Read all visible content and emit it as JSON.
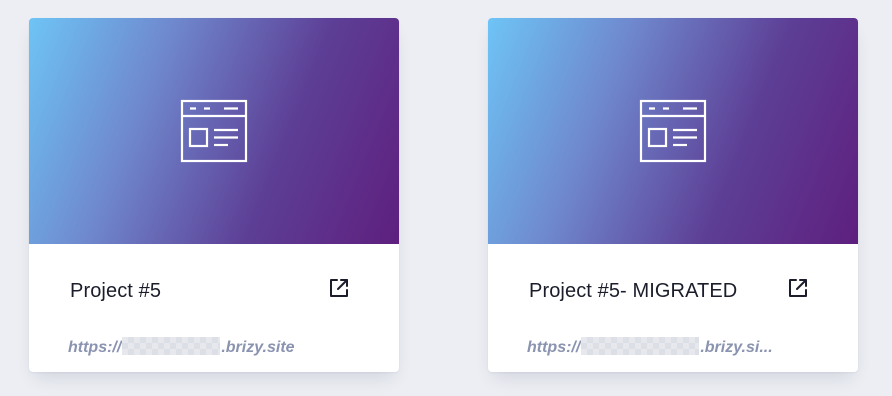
{
  "colors": {
    "page_background": "#eceef3",
    "card_background": "#ffffff",
    "gradient_start": "#6ec4f6",
    "gradient_end": "#5e1f7e",
    "title_text": "#1b1e2a",
    "url_text": "#8a93b0"
  },
  "projects": [
    {
      "title": "Project #5",
      "url_prefix": "https://",
      "url_suffix": ".brizy.site",
      "thumbnail_icon": "webpage-layout-icon",
      "action_icon": "external-link-icon"
    },
    {
      "title": "Project #5- MIGRATED",
      "url_prefix": "https://",
      "url_suffix": ".brizy.si...",
      "thumbnail_icon": "webpage-layout-icon",
      "action_icon": "external-link-icon"
    }
  ]
}
